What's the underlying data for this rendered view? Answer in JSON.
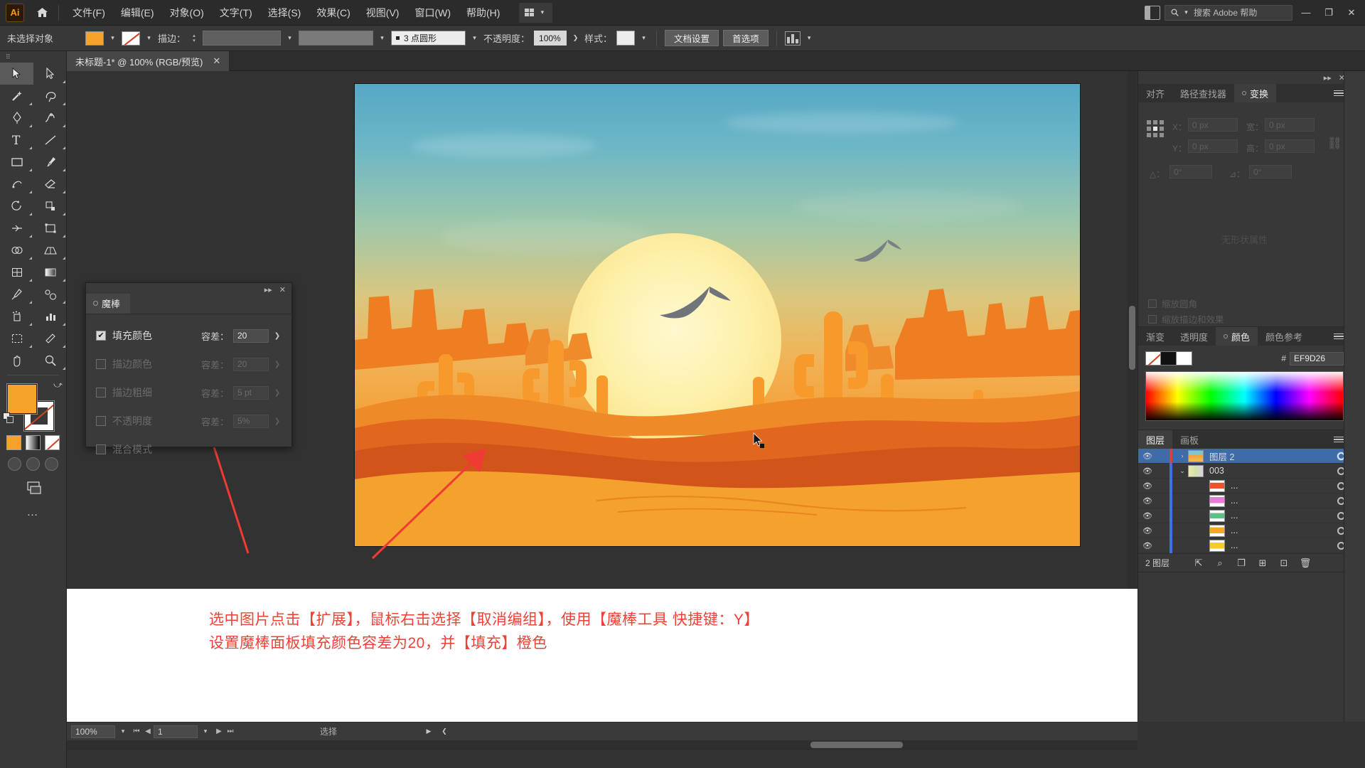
{
  "app": {
    "logo": "Ai",
    "home_icon": "home-icon"
  },
  "menubar": {
    "items": [
      "文件(F)",
      "编辑(E)",
      "对象(O)",
      "文字(T)",
      "选择(S)",
      "效果(C)",
      "视图(V)",
      "窗口(W)",
      "帮助(H)"
    ],
    "workspace_label": "",
    "search_placeholder": "搜索 Adobe 帮助",
    "window_buttons": [
      "—",
      "❐",
      "✕"
    ]
  },
  "controlbar": {
    "selection_status": "未选择对象",
    "stroke_label": "描边：",
    "stroke_weight": "",
    "stroke_profile": "",
    "brush_definition": "3 点圆形",
    "opacity_label": "不透明度：",
    "opacity_value": "100%",
    "style_label": "样式：",
    "doc_setup_button": "文档设置",
    "preferences_button": "首选项"
  },
  "tabbar": {
    "document_tab": "未标题-1* @ 100% (RGB/预览)",
    "close": "✕"
  },
  "toolbar": {
    "tools": [
      "selection-tool",
      "direct-selection-tool",
      "magic-wand-tool",
      "lasso-tool",
      "pen-tool",
      "curvature-tool",
      "type-tool",
      "line-segment-tool",
      "rectangle-tool",
      "paintbrush-tool",
      "shaper-tool",
      "eraser-tool",
      "rotate-tool",
      "scale-tool",
      "width-tool",
      "free-transform-tool",
      "shape-builder-tool",
      "perspective-grid-tool",
      "mesh-tool",
      "gradient-tool",
      "eyedropper-tool",
      "blend-tool",
      "symbol-sprayer-tool",
      "column-graph-tool",
      "artboard-tool",
      "slice-tool",
      "hand-tool",
      "zoom-tool"
    ],
    "fill_color": "#F5A32A",
    "stroke_color": "#FFFFFF",
    "more_tools": "…"
  },
  "magic_wand_panel": {
    "title": "魔棒",
    "close": "✕",
    "collapse": "▸▸",
    "rows": [
      {
        "label": "填充颜色",
        "checked": true,
        "enabled": true,
        "tolerance_label": "容差：",
        "tolerance_value": "20"
      },
      {
        "label": "描边颜色",
        "checked": false,
        "enabled": false,
        "tolerance_label": "容差：",
        "tolerance_value": "20"
      },
      {
        "label": "描边粗细",
        "checked": false,
        "enabled": false,
        "tolerance_label": "容差：",
        "tolerance_value": "5 pt"
      },
      {
        "label": "不透明度",
        "checked": false,
        "enabled": false,
        "tolerance_label": "容差：",
        "tolerance_value": "5%"
      },
      {
        "label": "混合模式",
        "checked": false,
        "enabled": false,
        "tolerance_label": "",
        "tolerance_value": ""
      }
    ]
  },
  "transform_panel": {
    "tabs": [
      {
        "label": "对齐",
        "active": false
      },
      {
        "label": "路径查找器",
        "active": false
      },
      {
        "label": "变换",
        "active": true
      }
    ],
    "fields": [
      {
        "label": "X：",
        "value": "0 px"
      },
      {
        "label": "Y：",
        "value": "0 px"
      },
      {
        "label": "宽：",
        "value": "0 px"
      },
      {
        "label": "高：",
        "value": "0 px"
      },
      {
        "label": "△：",
        "value": "0°"
      },
      {
        "label": "⊿：",
        "value": "0°"
      }
    ],
    "empty_note": "无形状属性",
    "checkboxes": [
      "缩放圆角",
      "缩放描边和效果"
    ],
    "close": "✕",
    "collapse": "▸▸"
  },
  "color_panel": {
    "tabs": [
      {
        "label": "渐变",
        "active": false
      },
      {
        "label": "透明度",
        "active": false
      },
      {
        "label": "颜色",
        "active": true
      },
      {
        "label": "颜色参考",
        "active": false
      }
    ],
    "hex_prefix": "#",
    "hex_value": "EF9D26",
    "swatches": [
      "none",
      "black",
      "white"
    ]
  },
  "layers_panel": {
    "tabs": [
      {
        "label": "图层",
        "active": true
      },
      {
        "label": "画板",
        "active": false
      }
    ],
    "rows": [
      {
        "name": "图层 2",
        "selected": true,
        "indent": 0,
        "expander": "›",
        "thumb": "#e8843a",
        "color": "#d0453a"
      },
      {
        "name": "003",
        "selected": false,
        "indent": 1,
        "expander": "⌄",
        "thumb": "#c8c8a8",
        "color": "#3f6ff0"
      },
      {
        "name": "...",
        "selected": false,
        "indent": 2,
        "expander": "",
        "thumb": "#f0502a",
        "color": "#3f6ff0"
      },
      {
        "name": "...",
        "selected": false,
        "indent": 2,
        "expander": "",
        "thumb": "#ee79d8",
        "color": "#3f6ff0"
      },
      {
        "name": "...",
        "selected": false,
        "indent": 2,
        "expander": "",
        "thumb": "#5fbe86",
        "color": "#3f6ff0"
      },
      {
        "name": "...",
        "selected": false,
        "indent": 2,
        "expander": "",
        "thumb": "#f0a922",
        "color": "#3f6ff0"
      },
      {
        "name": "...",
        "selected": false,
        "indent": 2,
        "expander": "",
        "thumb": "#f5cd26",
        "color": "#3f6ff0"
      }
    ],
    "footer_count": "2 图层",
    "footer_icons": [
      "locate-object-icon",
      "search-icon",
      "duplicate-layer-icon",
      "new-sublayer-icon",
      "new-layer-icon",
      "delete-layer-icon"
    ]
  },
  "annotation": {
    "line1": "选中图片点击【扩展】，鼠标右击选择【取消编组】，使用【魔棒工具 快捷键：Y】",
    "line2": "设置魔棒面板填充颜色容差为20，并【填充】橙色",
    "color": "#EF4136"
  },
  "statusbar": {
    "zoom": "100%",
    "page": "1",
    "status_text": "选择"
  },
  "artwork": {
    "title": "desert-sunset-illustration",
    "palette": {
      "sky_top": "#56A8C6",
      "sky_mid": "#9EC7AB",
      "sky_low": "#D9C77F",
      "sun": "#FDF0A9",
      "sand_front": "#F5A12E",
      "mesa_orange": "#EF7E22",
      "dune_dark": "#D1551A",
      "cactus": "#F79A2B"
    }
  }
}
